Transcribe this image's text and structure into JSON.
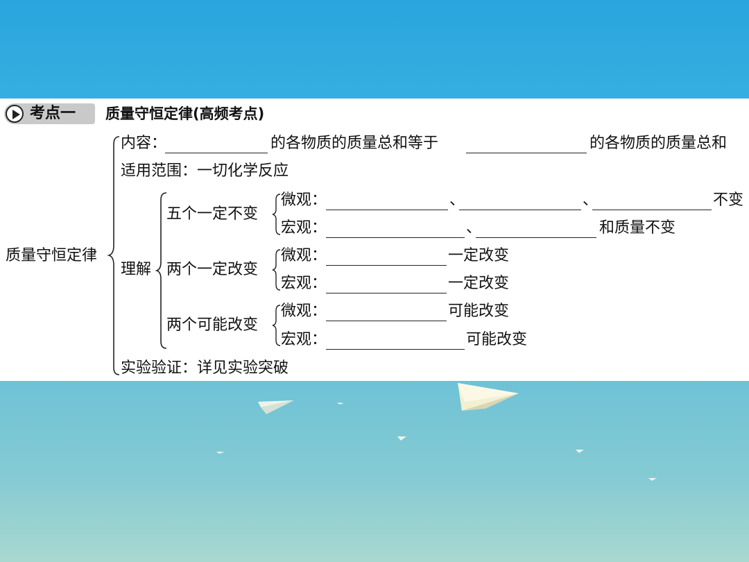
{
  "heading": {
    "badge_label": "考点一",
    "title": "质量守恒定律(高频考点)"
  },
  "outline": {
    "root": "质量守恒定律",
    "content_label": "内容：",
    "content_mid": "的各物质的质量总和等于",
    "content_end": "的各物质的质量总和",
    "scope": "适用范围：一切化学反应",
    "understand_label": "理解",
    "five_constant": "五个一定不变",
    "micro_label": "微观：",
    "macro_label": "宏观：",
    "sep1": "、",
    "sep2": "、",
    "sep3": "、",
    "unchanged": "不变",
    "mass_unchanged": "和质量不变",
    "two_change": "两个一定改变",
    "must_change_1": "一定改变",
    "must_change_2": "一定改变",
    "two_possible": "两个可能改变",
    "may_change_1": "可能改变",
    "may_change_2": "可能改变",
    "verify": "实验验证：详见实验突破"
  },
  "colors": {
    "top_band": "#2aa5de",
    "bottom_band": "#86cbd3",
    "badge": "#c9c9c9"
  }
}
